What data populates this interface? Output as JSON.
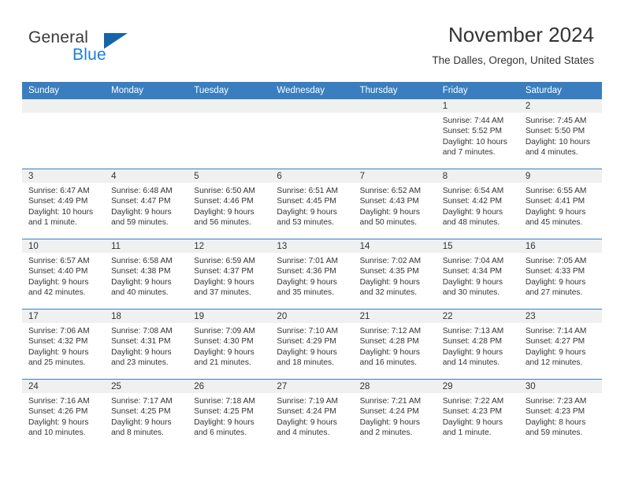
{
  "brand": {
    "name_part1": "General",
    "name_part2": "Blue",
    "triangle_color": "#1565a8",
    "blue_color": "#1b7fd4"
  },
  "header": {
    "title": "November 2024",
    "subtitle": "The Dalles, Oregon, United States"
  },
  "theme": {
    "header_row_bg": "#3a7ebf",
    "daynum_bg": "#f0f0f0",
    "grid_line": "#3a7ebf",
    "text": "#333333"
  },
  "weekdays": [
    "Sunday",
    "Monday",
    "Tuesday",
    "Wednesday",
    "Thursday",
    "Friday",
    "Saturday"
  ],
  "weeks": [
    [
      {
        "day": "",
        "sunrise": "",
        "sunset": "",
        "daylight1": "",
        "daylight2": ""
      },
      {
        "day": "",
        "sunrise": "",
        "sunset": "",
        "daylight1": "",
        "daylight2": ""
      },
      {
        "day": "",
        "sunrise": "",
        "sunset": "",
        "daylight1": "",
        "daylight2": ""
      },
      {
        "day": "",
        "sunrise": "",
        "sunset": "",
        "daylight1": "",
        "daylight2": ""
      },
      {
        "day": "",
        "sunrise": "",
        "sunset": "",
        "daylight1": "",
        "daylight2": ""
      },
      {
        "day": "1",
        "sunrise": "Sunrise: 7:44 AM",
        "sunset": "Sunset: 5:52 PM",
        "daylight1": "Daylight: 10 hours",
        "daylight2": "and 7 minutes."
      },
      {
        "day": "2",
        "sunrise": "Sunrise: 7:45 AM",
        "sunset": "Sunset: 5:50 PM",
        "daylight1": "Daylight: 10 hours",
        "daylight2": "and 4 minutes."
      }
    ],
    [
      {
        "day": "3",
        "sunrise": "Sunrise: 6:47 AM",
        "sunset": "Sunset: 4:49 PM",
        "daylight1": "Daylight: 10 hours",
        "daylight2": "and 1 minute."
      },
      {
        "day": "4",
        "sunrise": "Sunrise: 6:48 AM",
        "sunset": "Sunset: 4:47 PM",
        "daylight1": "Daylight: 9 hours",
        "daylight2": "and 59 minutes."
      },
      {
        "day": "5",
        "sunrise": "Sunrise: 6:50 AM",
        "sunset": "Sunset: 4:46 PM",
        "daylight1": "Daylight: 9 hours",
        "daylight2": "and 56 minutes."
      },
      {
        "day": "6",
        "sunrise": "Sunrise: 6:51 AM",
        "sunset": "Sunset: 4:45 PM",
        "daylight1": "Daylight: 9 hours",
        "daylight2": "and 53 minutes."
      },
      {
        "day": "7",
        "sunrise": "Sunrise: 6:52 AM",
        "sunset": "Sunset: 4:43 PM",
        "daylight1": "Daylight: 9 hours",
        "daylight2": "and 50 minutes."
      },
      {
        "day": "8",
        "sunrise": "Sunrise: 6:54 AM",
        "sunset": "Sunset: 4:42 PM",
        "daylight1": "Daylight: 9 hours",
        "daylight2": "and 48 minutes."
      },
      {
        "day": "9",
        "sunrise": "Sunrise: 6:55 AM",
        "sunset": "Sunset: 4:41 PM",
        "daylight1": "Daylight: 9 hours",
        "daylight2": "and 45 minutes."
      }
    ],
    [
      {
        "day": "10",
        "sunrise": "Sunrise: 6:57 AM",
        "sunset": "Sunset: 4:40 PM",
        "daylight1": "Daylight: 9 hours",
        "daylight2": "and 42 minutes."
      },
      {
        "day": "11",
        "sunrise": "Sunrise: 6:58 AM",
        "sunset": "Sunset: 4:38 PM",
        "daylight1": "Daylight: 9 hours",
        "daylight2": "and 40 minutes."
      },
      {
        "day": "12",
        "sunrise": "Sunrise: 6:59 AM",
        "sunset": "Sunset: 4:37 PM",
        "daylight1": "Daylight: 9 hours",
        "daylight2": "and 37 minutes."
      },
      {
        "day": "13",
        "sunrise": "Sunrise: 7:01 AM",
        "sunset": "Sunset: 4:36 PM",
        "daylight1": "Daylight: 9 hours",
        "daylight2": "and 35 minutes."
      },
      {
        "day": "14",
        "sunrise": "Sunrise: 7:02 AM",
        "sunset": "Sunset: 4:35 PM",
        "daylight1": "Daylight: 9 hours",
        "daylight2": "and 32 minutes."
      },
      {
        "day": "15",
        "sunrise": "Sunrise: 7:04 AM",
        "sunset": "Sunset: 4:34 PM",
        "daylight1": "Daylight: 9 hours",
        "daylight2": "and 30 minutes."
      },
      {
        "day": "16",
        "sunrise": "Sunrise: 7:05 AM",
        "sunset": "Sunset: 4:33 PM",
        "daylight1": "Daylight: 9 hours",
        "daylight2": "and 27 minutes."
      }
    ],
    [
      {
        "day": "17",
        "sunrise": "Sunrise: 7:06 AM",
        "sunset": "Sunset: 4:32 PM",
        "daylight1": "Daylight: 9 hours",
        "daylight2": "and 25 minutes."
      },
      {
        "day": "18",
        "sunrise": "Sunrise: 7:08 AM",
        "sunset": "Sunset: 4:31 PM",
        "daylight1": "Daylight: 9 hours",
        "daylight2": "and 23 minutes."
      },
      {
        "day": "19",
        "sunrise": "Sunrise: 7:09 AM",
        "sunset": "Sunset: 4:30 PM",
        "daylight1": "Daylight: 9 hours",
        "daylight2": "and 21 minutes."
      },
      {
        "day": "20",
        "sunrise": "Sunrise: 7:10 AM",
        "sunset": "Sunset: 4:29 PM",
        "daylight1": "Daylight: 9 hours",
        "daylight2": "and 18 minutes."
      },
      {
        "day": "21",
        "sunrise": "Sunrise: 7:12 AM",
        "sunset": "Sunset: 4:28 PM",
        "daylight1": "Daylight: 9 hours",
        "daylight2": "and 16 minutes."
      },
      {
        "day": "22",
        "sunrise": "Sunrise: 7:13 AM",
        "sunset": "Sunset: 4:28 PM",
        "daylight1": "Daylight: 9 hours",
        "daylight2": "and 14 minutes."
      },
      {
        "day": "23",
        "sunrise": "Sunrise: 7:14 AM",
        "sunset": "Sunset: 4:27 PM",
        "daylight1": "Daylight: 9 hours",
        "daylight2": "and 12 minutes."
      }
    ],
    [
      {
        "day": "24",
        "sunrise": "Sunrise: 7:16 AM",
        "sunset": "Sunset: 4:26 PM",
        "daylight1": "Daylight: 9 hours",
        "daylight2": "and 10 minutes."
      },
      {
        "day": "25",
        "sunrise": "Sunrise: 7:17 AM",
        "sunset": "Sunset: 4:25 PM",
        "daylight1": "Daylight: 9 hours",
        "daylight2": "and 8 minutes."
      },
      {
        "day": "26",
        "sunrise": "Sunrise: 7:18 AM",
        "sunset": "Sunset: 4:25 PM",
        "daylight1": "Daylight: 9 hours",
        "daylight2": "and 6 minutes."
      },
      {
        "day": "27",
        "sunrise": "Sunrise: 7:19 AM",
        "sunset": "Sunset: 4:24 PM",
        "daylight1": "Daylight: 9 hours",
        "daylight2": "and 4 minutes."
      },
      {
        "day": "28",
        "sunrise": "Sunrise: 7:21 AM",
        "sunset": "Sunset: 4:24 PM",
        "daylight1": "Daylight: 9 hours",
        "daylight2": "and 2 minutes."
      },
      {
        "day": "29",
        "sunrise": "Sunrise: 7:22 AM",
        "sunset": "Sunset: 4:23 PM",
        "daylight1": "Daylight: 9 hours",
        "daylight2": "and 1 minute."
      },
      {
        "day": "30",
        "sunrise": "Sunrise: 7:23 AM",
        "sunset": "Sunset: 4:23 PM",
        "daylight1": "Daylight: 8 hours",
        "daylight2": "and 59 minutes."
      }
    ]
  ]
}
